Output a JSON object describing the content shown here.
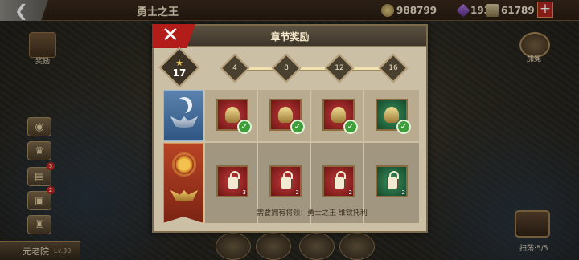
{
  "topbar": {
    "title": "勇士之王",
    "resources": {
      "gold": "988799",
      "gems": "1935",
      "medals": "61789"
    },
    "back_icon": "back-arrow-icon",
    "plus_label": "+"
  },
  "left": {
    "chest_label": "奖励",
    "badges": [
      "3",
      "2"
    ],
    "senate_name": "元老院",
    "senate_level": "Lv.30"
  },
  "right": {
    "shield_label": "加冕",
    "raid_label": "扫荡:",
    "raid_count": "5/5"
  },
  "modal": {
    "title": "章节奖励",
    "close_label": "✕",
    "stars": "17",
    "star_glyph": "★",
    "milestones": [
      "4",
      "8",
      "12",
      "16"
    ],
    "row1": [
      {
        "icon": "gladiator-helmet-icon",
        "color": "red",
        "claimed": true
      },
      {
        "icon": "bracelet-icon",
        "color": "red",
        "claimed": true
      },
      {
        "icon": "crown-icon",
        "color": "red",
        "claimed": true
      },
      {
        "icon": "armor-icon",
        "color": "green",
        "claimed": true
      }
    ],
    "row2": [
      {
        "icon": "gladiator-helmet-icon",
        "color": "red",
        "locked": true,
        "qty": "3"
      },
      {
        "icon": "bracelet-icon",
        "color": "red",
        "locked": true,
        "qty": "2"
      },
      {
        "icon": "crown-icon",
        "color": "red",
        "locked": true,
        "qty": "2"
      },
      {
        "icon": "armor-icon",
        "color": "green",
        "locked": true,
        "qty": "2"
      }
    ],
    "requirement": "需要拥有将领：勇士之王 维钦托利",
    "check_glyph": "✓"
  }
}
